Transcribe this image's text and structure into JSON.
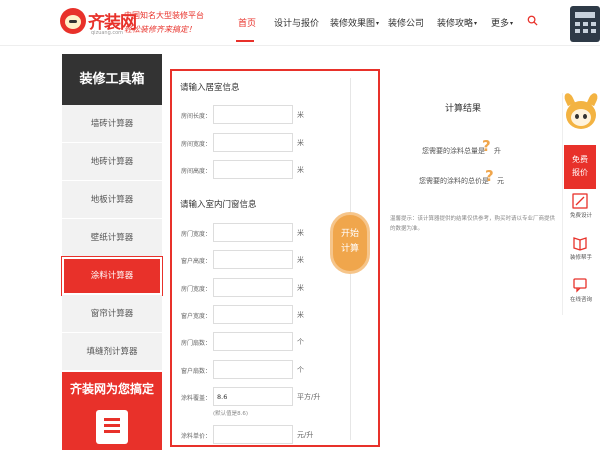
{
  "header": {
    "logo_text": "齐装网",
    "logo_domain": "qizuang.com",
    "slogan_line1": "中国知名大型装修平台",
    "slogan_line2": "轻松装修齐来搞定！",
    "nav": [
      {
        "label": "首页",
        "active": true,
        "caret": false
      },
      {
        "label": "设计与报价",
        "active": false,
        "caret": false
      },
      {
        "label": "装修效果图",
        "active": false,
        "caret": true
      },
      {
        "label": "装修公司",
        "active": false,
        "caret": false
      },
      {
        "label": "装修攻略",
        "active": false,
        "caret": true
      },
      {
        "label": "更多",
        "active": false,
        "caret": true
      }
    ],
    "caret_glyph": "▾"
  },
  "sidebar": {
    "title": "装修工具箱",
    "items": [
      {
        "label": "墙砖计算器",
        "active": false
      },
      {
        "label": "地砖计算器",
        "active": false
      },
      {
        "label": "地板计算器",
        "active": false
      },
      {
        "label": "壁纸计算器",
        "active": false
      },
      {
        "label": "涂料计算器",
        "active": true
      },
      {
        "label": "窗帘计算器",
        "active": false
      },
      {
        "label": "填缝剂计算器",
        "active": false
      }
    ],
    "banner_text": "齐装网为您搞定"
  },
  "form": {
    "room_section_title": "请输入居室信息",
    "room_fields": [
      {
        "label": "房间长度：",
        "value": "",
        "unit": "米"
      },
      {
        "label": "房间宽度：",
        "value": "",
        "unit": "米"
      },
      {
        "label": "房间高度：",
        "value": "",
        "unit": "米"
      }
    ],
    "door_section_title": "请输入室内门窗信息",
    "door_fields": [
      {
        "label": "房门宽度：",
        "value": "",
        "unit": "米"
      },
      {
        "label": "窗户高度：",
        "value": "",
        "unit": "米"
      },
      {
        "label": "房门宽度：",
        "value": "",
        "unit": "米"
      },
      {
        "label": "窗户宽度：",
        "value": "",
        "unit": "米"
      },
      {
        "label": "房门扇数：",
        "value": "",
        "unit": "个"
      },
      {
        "label": "窗户扇数：",
        "value": "",
        "unit": "个"
      },
      {
        "label": "涂料覆盖：",
        "value": "8.6",
        "unit": "平方/升"
      },
      {
        "label": "涂料单价：",
        "value": "",
        "unit": "元/升"
      }
    ],
    "coverage_note": "(默认值是8.6)",
    "calc_button_line1": "开始",
    "calc_button_line2": "计算"
  },
  "result": {
    "title": "计算结果",
    "quantity_label": "您需要的涂料总量是",
    "quantity_value": "?",
    "quantity_unit": "升",
    "price_label": "您需要的涂料的总价是",
    "price_value": "?",
    "price_unit": "元",
    "tip": "温馨提示：该计算器提供的结果仅供参考，购买时请以专业厂商提供的数据为准。"
  },
  "float_bar": {
    "free_quote_line1": "免费",
    "free_quote_line2": "报价",
    "items": [
      {
        "label": "免费设计"
      },
      {
        "label": "装修帮手"
      },
      {
        "label": "在线咨询"
      }
    ]
  },
  "colors": {
    "brand_red": "#e8312a",
    "accent_orange": "#f0a64c",
    "sidebar_dark": "#333333"
  }
}
